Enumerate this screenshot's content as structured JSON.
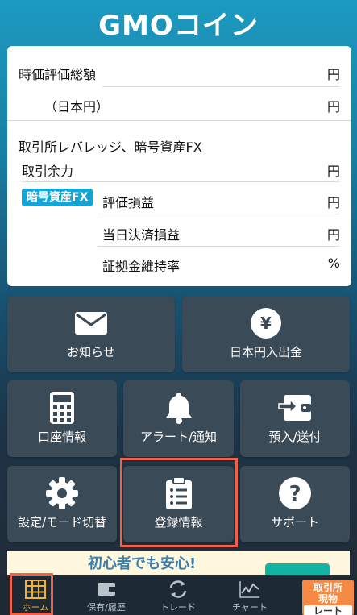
{
  "app": {
    "logo": "GMOコイン"
  },
  "summary": {
    "valuation_total": "時価評価総額",
    "jpy": "（日本円）",
    "exchange_section": "取引所レバレッジ、暗号資産FX",
    "margin_available": "取引余力",
    "fx_badge": "暗号資産FX",
    "unrealized_pl": "評価損益",
    "daily_settlement_pl": "当日決済損益",
    "margin_ratio": "証拠金維持率",
    "unit_yen": "円",
    "unit_percent": "%"
  },
  "tiles": {
    "notice": "お知らせ",
    "jpy_deposit": "日本円入出金",
    "account_info": "口座情報",
    "alert": "アラート/通知",
    "transfer": "預入/送付",
    "settings": "設定/モード切替",
    "registration": "登録情報",
    "support": "サポート"
  },
  "banner": {
    "text": "初心者でも安心!"
  },
  "tabbar": {
    "home": "ホーム",
    "holdings": "保有/履歴",
    "trade": "トレード",
    "chart": "チャート",
    "rate_line1": "取引所",
    "rate_line2": "現物",
    "rate_line3": "レート"
  },
  "colors": {
    "highlight": "#f0614c",
    "active_tab": "#f2b330",
    "fx_badge": "#12a6d6",
    "rate_tab": "#f58a44"
  }
}
